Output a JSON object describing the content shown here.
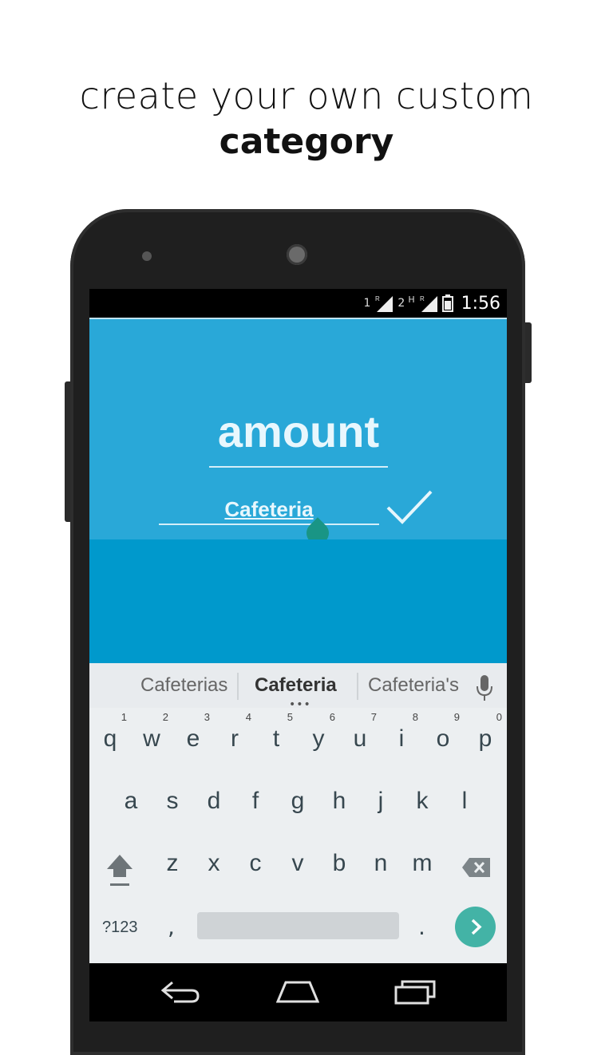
{
  "headline": {
    "line1": "create your own custom",
    "line2": "category"
  },
  "statusbar": {
    "sim1": "1",
    "sim2": "2",
    "roaming": "R",
    "network": "H",
    "time": "1:56"
  },
  "app": {
    "amount_label": "amount",
    "category_value": "Cafeteria",
    "accent_top": "#29a8d8",
    "accent_bottom": "#0099cc"
  },
  "suggestions": [
    "Cafeterias",
    "Cafeteria",
    "Cafeteria's"
  ],
  "keyboard": {
    "row1": [
      {
        "k": "q",
        "n": "1"
      },
      {
        "k": "w",
        "n": "2"
      },
      {
        "k": "e",
        "n": "3"
      },
      {
        "k": "r",
        "n": "4"
      },
      {
        "k": "t",
        "n": "5"
      },
      {
        "k": "y",
        "n": "6"
      },
      {
        "k": "u",
        "n": "7"
      },
      {
        "k": "i",
        "n": "8"
      },
      {
        "k": "o",
        "n": "9"
      },
      {
        "k": "p",
        "n": "0"
      }
    ],
    "row2": [
      "a",
      "s",
      "d",
      "f",
      "g",
      "h",
      "j",
      "k",
      "l"
    ],
    "row3": [
      "z",
      "x",
      "c",
      "v",
      "b",
      "n",
      "m"
    ],
    "symbols_label": "?123",
    "comma": ",",
    "period": "."
  },
  "icons": {
    "confirm": "check-icon",
    "mic": "microphone-icon",
    "shift": "shift-icon",
    "delete": "backspace-icon",
    "enter": "next-arrow-icon",
    "nav": [
      "back-icon",
      "home-icon",
      "recents-icon"
    ]
  }
}
